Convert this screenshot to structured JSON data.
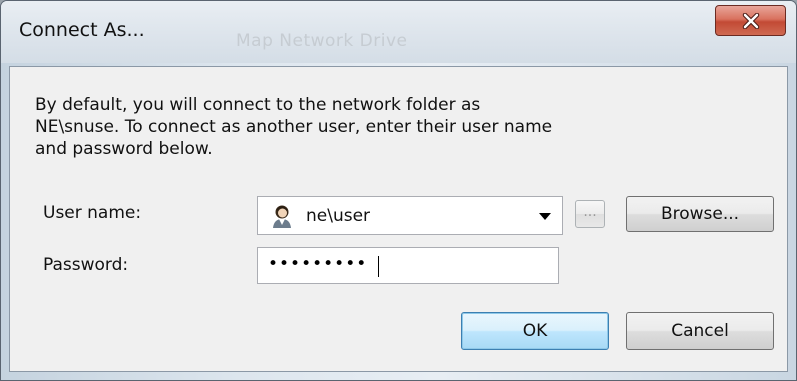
{
  "window": {
    "title": "Connect As...",
    "background_title": "Map Network Drive"
  },
  "dialog": {
    "description_lines": [
      "By default, you will connect to the network folder as",
      "NE\\snuse. To connect as another user, enter their user name",
      "and password below."
    ],
    "username_label": "User name:",
    "username_value": "ne\\user",
    "password_label": "Password:",
    "password_masked": "•••••••••",
    "ellipsis_label": "...",
    "browse_label": "Browse...",
    "ok_label": "OK",
    "cancel_label": "Cancel"
  },
  "icons": {
    "close": "close-icon",
    "user": "user-icon",
    "dropdown": "chevron-down-icon"
  },
  "colors": {
    "close_button": "#c24a35",
    "ok_border": "#3c7fb1",
    "panel_bg": "#f0f0f0"
  }
}
